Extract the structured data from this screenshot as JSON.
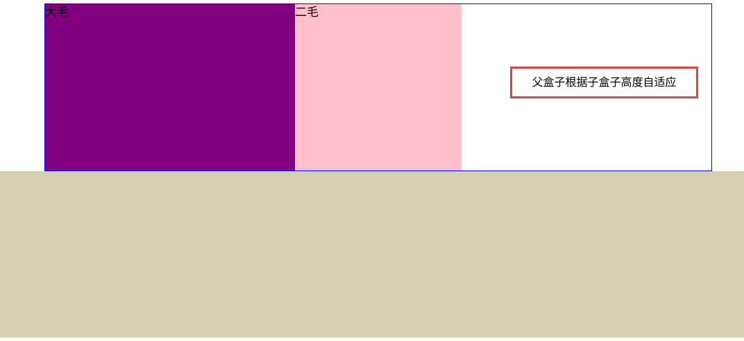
{
  "boxes": {
    "big": {
      "label": "大毛",
      "color": "#800080"
    },
    "second": {
      "label": "二毛",
      "color": "#ffc0cb"
    }
  },
  "annotation": {
    "text": "父盒子根据子盒子高度自适应",
    "border_color": "#e5403a"
  },
  "parent": {
    "border_color": "#0000ff"
  },
  "footer": {
    "color": "#d6cfb3"
  }
}
